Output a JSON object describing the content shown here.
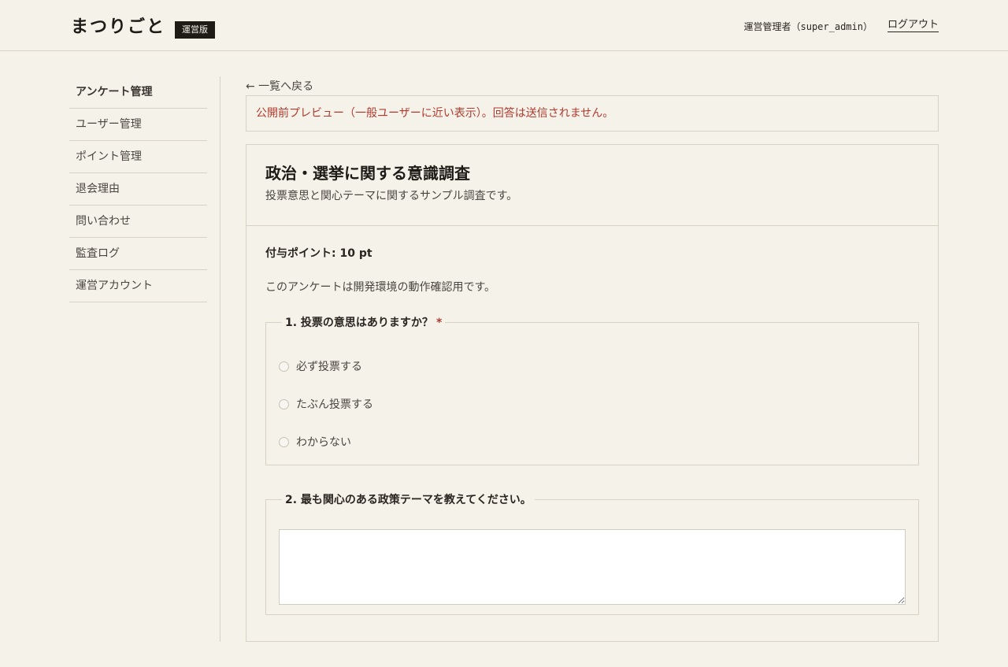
{
  "header": {
    "logo": "まつりごと",
    "edition_badge": "運営版",
    "admin_role": "運営管理者（",
    "admin_username": "super_admin",
    "admin_close": "）",
    "logout": "ログアウト"
  },
  "sidebar": {
    "items": [
      {
        "label": "アンケート管理",
        "active": true
      },
      {
        "label": "ユーザー管理"
      },
      {
        "label": "ポイント管理"
      },
      {
        "label": "退会理由"
      },
      {
        "label": "問い合わせ"
      },
      {
        "label": "監査ログ"
      },
      {
        "label": "運営アカウント"
      }
    ]
  },
  "main": {
    "back_link": "← 一覧へ戻る",
    "preview_notice": "公開前プレビュー（一般ユーザーに近い表示）。回答は送信されません。",
    "survey": {
      "title": "政治・選挙に関する意識調査",
      "description": "投票意思と関心テーマに関するサンプル調査です。",
      "points": "付与ポイント: 10 pt",
      "note": "このアンケートは開発環境の動作確認用です。",
      "questions": [
        {
          "label": "1. 投票の意思はありますか？",
          "required_mark": "*",
          "options": [
            "必ず投票する",
            "たぶん投票する",
            "わからない"
          ]
        },
        {
          "label": "2. 最も関心のある政策テーマを教えてください。",
          "answer_value": ""
        }
      ]
    }
  },
  "colors": {
    "background": "#f5f2ea",
    "accent_red": "#b03a2e",
    "border": "#d8d2c4",
    "badge_bg": "#1e1a16"
  }
}
